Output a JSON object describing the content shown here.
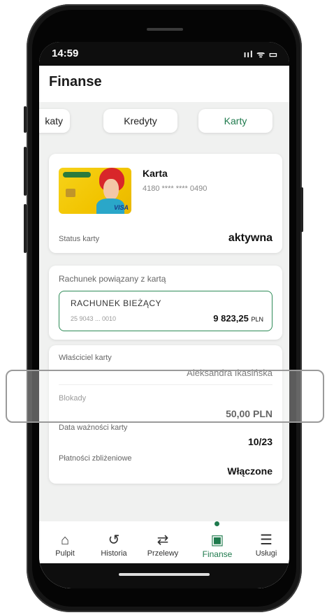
{
  "status_bar": {
    "time": "14:59",
    "icons": "ııl ᯤ ▭"
  },
  "app_bar": {
    "title": "Finanse"
  },
  "tabs": [
    {
      "label": "katy",
      "active": false
    },
    {
      "label": "Kredyty",
      "active": false
    },
    {
      "label": "Karty",
      "active": true
    }
  ],
  "card_info": {
    "name": "Karta",
    "number": "4180 **** **** 0490",
    "image_text": "VISA",
    "status_label": "Status karty",
    "status_value": "aktywna"
  },
  "linked_account": {
    "section_label": "Rachunek powiązany z kartą",
    "account_name": "RACHUNEK BIEŻĄCY",
    "account_number": "25 9043 ... 0010",
    "balance": "9 823,25",
    "currency": "PLN"
  },
  "details": {
    "owner_label": "Właściciel karty",
    "owner_value": "Aleksandra Ikasińska",
    "blocks_label": "Blokady",
    "blocks_value": "50,00 PLN",
    "expiry_label": "Data ważności karty",
    "expiry_value": "10/23",
    "contactless_label": "Płatności zbliżeniowe",
    "contactless_value": "Włączone"
  },
  "nav": [
    {
      "label": "Pulpit",
      "icon": "home-icon",
      "glyph": "⌂",
      "active": false
    },
    {
      "label": "Historia",
      "icon": "history-icon",
      "glyph": "↺",
      "active": false
    },
    {
      "label": "Przelewy",
      "icon": "transfer-icon",
      "glyph": "⇄",
      "active": false
    },
    {
      "label": "Finanse",
      "icon": "finance-icon",
      "glyph": "▣",
      "active": true
    },
    {
      "label": "Usługi",
      "icon": "services-icon",
      "glyph": "☰",
      "active": false
    }
  ],
  "colors": {
    "accent": "#1f7a4d",
    "background": "#f0f1f0",
    "card": "#ffffff"
  }
}
